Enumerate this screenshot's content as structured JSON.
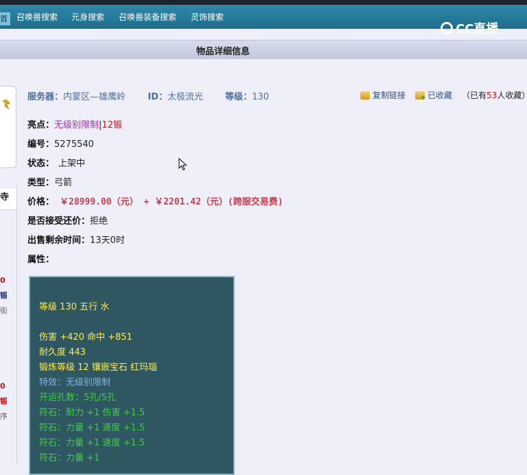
{
  "nav": {
    "first": "首",
    "items": [
      "召唤兽搜索",
      "元身搜索",
      "召唤兽装备搜索",
      "灵饰搜索"
    ]
  },
  "logo": {
    "text": "CC直播"
  },
  "title": "物品详细信息",
  "left": {
    "tab": "寺",
    "frags": [
      "0",
      "锻",
      "街",
      "0",
      "锻",
      "序"
    ]
  },
  "info": {
    "server_label": "服务器：",
    "server_value": "内蒙区—雄鹰岭",
    "id_label": "ID：",
    "id_value": "太极流光",
    "level_label": "等级：",
    "level_value": "130",
    "copy_link": "复制链接",
    "favorited": "已收藏",
    "count_pre": "（已有",
    "count_num": "53",
    "count_post": "人收藏）"
  },
  "details": {
    "highlight_label": "亮点：",
    "highlight_a": "无级别限制",
    "highlight_sep": "|",
    "highlight_b": "12锻",
    "number_label": "编号：",
    "number_value": "5275540",
    "status_label": "状态：",
    "status_value": "上架中",
    "type_label": "类型：",
    "type_value": "弓箭",
    "price_label": "价格：",
    "price_value": "￥28999.00（元） + ￥2201.42（元）(跨服交易费)",
    "counter_label": "是否接受还价：",
    "counter_value": "拒绝",
    "remain_label": "出售剩余时间：",
    "remain_value": "13天0时",
    "attr_label": "属性："
  },
  "attributes": [
    {
      "text": "等级 130 五行 水",
      "color": "#ffee4a"
    },
    {
      "text": "伤害 +420 命中 +851",
      "color": "#ffee4a"
    },
    {
      "text": "耐久度 443",
      "color": "#ffee4a"
    },
    {
      "text": "锻炼等级 12 镶嵌宝石 红玛瑙",
      "color": "#ffee4a"
    },
    {
      "text": "特效：无级别限制",
      "color": "#7fb8e0"
    },
    {
      "text": "开运孔数：5孔/5孔",
      "color": "#39d439"
    },
    {
      "text": "符石：耐力 +1 伤害 +1.5",
      "color": "#39d439"
    },
    {
      "text": "符石：力量 +1 速度 +1.5",
      "color": "#39d439"
    },
    {
      "text": "符石：力量 +1 速度 +1.5",
      "color": "#39d439"
    },
    {
      "text": "符石：力量 +1",
      "color": "#39d439"
    }
  ]
}
